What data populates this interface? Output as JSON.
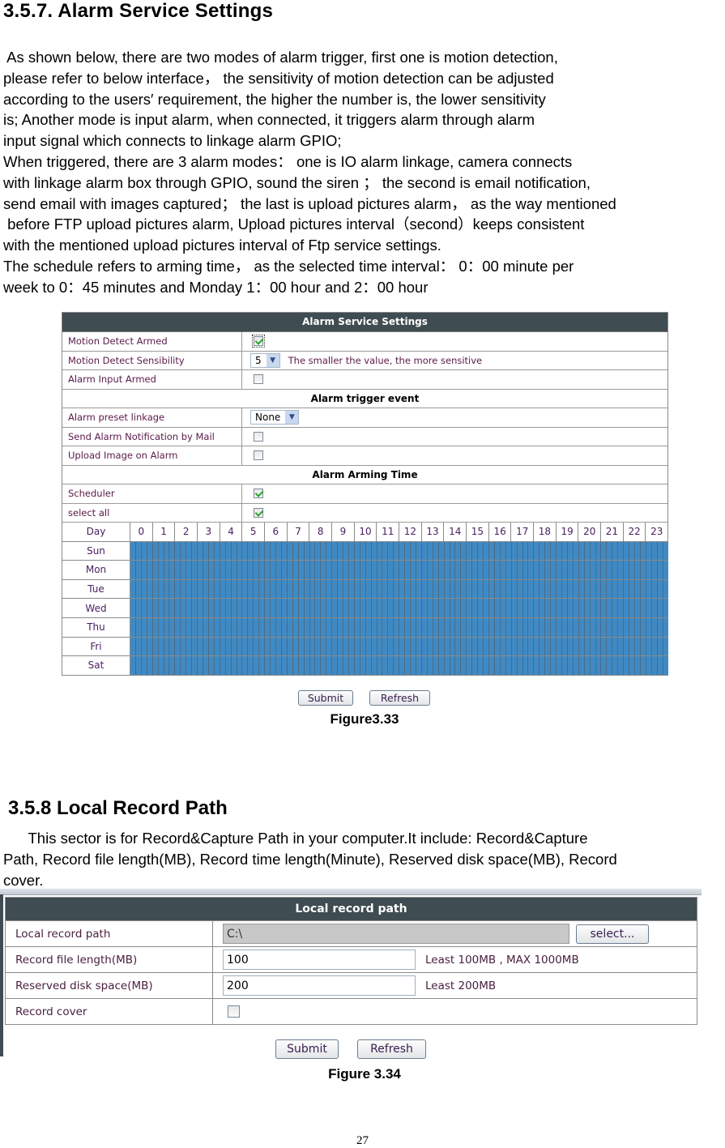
{
  "section1": {
    "title": "3.5.7. Alarm Service Settings",
    "paragraph_lines": [
      " As shown below, there are two modes of alarm trigger, first one is motion detection,",
      "please refer to below interface， the sensitivity of motion detection can be adjusted",
      "according to the users′ requirement, the higher the number is, the lower sensitivity",
      "is; Another mode is input alarm, when connected, it triggers alarm through alarm",
      "input signal which connects to linkage alarm GPIO;",
      "When triggered, there are 3 alarm modes： one is IO alarm linkage, camera connects",
      "with linkage alarm box through GPIO, sound the siren ； the second is email notification,",
      "send email with images captured； the last is upload pictures alarm， as the way mentioned",
      " before FTP upload pictures alarm, Upload pictures interval（second）keeps consistent",
      "with the mentioned upload pictures interval of Ftp service settings.",
      "The schedule refers to arming time， as the selected time interval： 0：00 minute per",
      "week to 0：45 minutes and Monday 1：00 hour and 2：00 hour"
    ],
    "figure_caption": "Figure3.33"
  },
  "alarm_panel": {
    "header": "Alarm Service Settings",
    "motion_detect_armed": {
      "label": "Motion Detect Armed",
      "checked": true
    },
    "motion_detect_sensibility": {
      "label": "Motion Detect Sensibility",
      "value": "5",
      "hint": "The smaller the value, the more sensitive"
    },
    "alarm_input_armed": {
      "label": "Alarm Input Armed",
      "checked": false
    },
    "trigger_section": "Alarm trigger event",
    "alarm_preset_linkage": {
      "label": "Alarm preset linkage",
      "value": "None"
    },
    "send_mail": {
      "label": "Send Alarm Notification by Mail",
      "checked": false
    },
    "upload_image": {
      "label": "Upload Image on Alarm",
      "checked": false
    },
    "arming_section": "Alarm Arming Time",
    "scheduler": {
      "label": "Scheduler",
      "checked": true
    },
    "select_all": {
      "label": "select all",
      "checked": true
    },
    "schedule": {
      "day_header": "Day",
      "hours": [
        "0",
        "1",
        "2",
        "3",
        "4",
        "5",
        "6",
        "7",
        "8",
        "9",
        "10",
        "11",
        "12",
        "13",
        "14",
        "15",
        "16",
        "17",
        "18",
        "19",
        "20",
        "21",
        "22",
        "23"
      ],
      "days": [
        "Sun",
        "Mon",
        "Tue",
        "Wed",
        "Thu",
        "Fri",
        "Sat"
      ],
      "slots_per_hour": 4,
      "all_selected": true,
      "selected_color": "#3f8ac4"
    },
    "submit_label": "Submit",
    "refresh_label": "Refresh"
  },
  "section2": {
    "title": "3.5.8 Local Record Path",
    "paragraph_lines": [
      "      This sector is for Record&Capture Path in your computer.It include: Record&Capture",
      "Path, Record file length(MB), Record time length(Minute), Reserved disk space(MB), Record",
      "cover."
    ],
    "figure_caption": "Figure 3.34"
  },
  "record_panel": {
    "header": "Local record path",
    "local_record_path": {
      "label": "Local record path",
      "value": "C:\\",
      "button": "select..."
    },
    "record_file_length": {
      "label": "Record file length(MB)",
      "value": "100",
      "note": "Least 100MB , MAX 1000MB"
    },
    "reserved_disk_space": {
      "label": "Reserved disk space(MB)",
      "value": "200",
      "note": "Least 200MB"
    },
    "record_cover": {
      "label": "Record cover",
      "checked": false
    },
    "submit_label": "Submit",
    "refresh_label": "Refresh"
  },
  "page_number": "27"
}
